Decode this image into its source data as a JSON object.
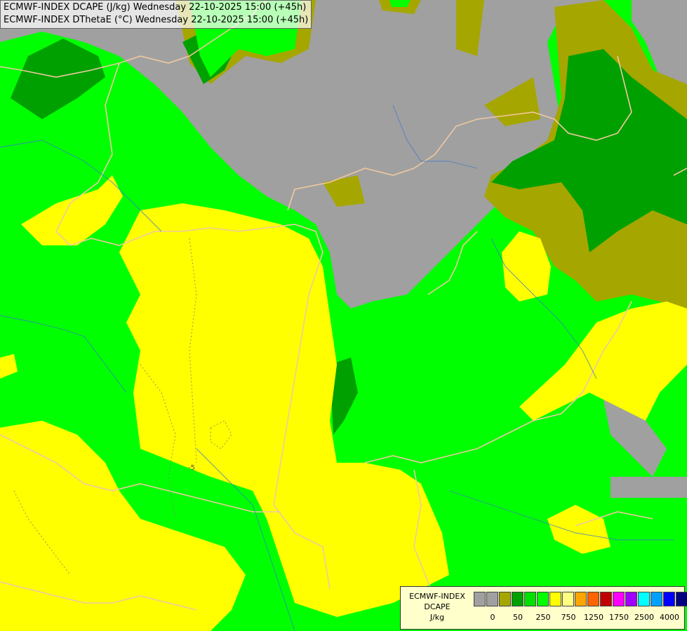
{
  "header": {
    "line1": "ECMWF-INDEX DCAPE (J/kg) Wednesday 22-10-2025 15:00 (+45h)",
    "line2": "ECMWF-INDEX DThetaE (°C) Wednesday 22-10-2025 15:00 (+45h)"
  },
  "map": {
    "contour_label": "-5",
    "colors": {
      "grey": "#a0a0a0",
      "olive": "#a6a600",
      "dark_green": "#00a000",
      "green": "#00e100",
      "bright_green": "#00ff00",
      "yellow": "#ffff00",
      "border_line": "#f0c8a0",
      "river_line": "#3c78c8",
      "contour_line": "#7f7f7f"
    }
  },
  "legend": {
    "title_line1": "ECMWF-INDEX",
    "title_line2": "DCAPE",
    "title_line3": "J/kg",
    "swatches": [
      "#a0a0a0",
      "#a0a0a0",
      "#a6a600",
      "#00a000",
      "#00e100",
      "#00ff00",
      "#ffff00",
      "#ffff80",
      "#ffa500",
      "#ff6400",
      "#c00000",
      "#ff00ff",
      "#a000ff",
      "#00ffff",
      "#00a0ff",
      "#0000ff",
      "#000080"
    ],
    "ticks": [
      "0",
      "50",
      "250",
      "750",
      "1250",
      "1750",
      "2500",
      "4000"
    ]
  }
}
